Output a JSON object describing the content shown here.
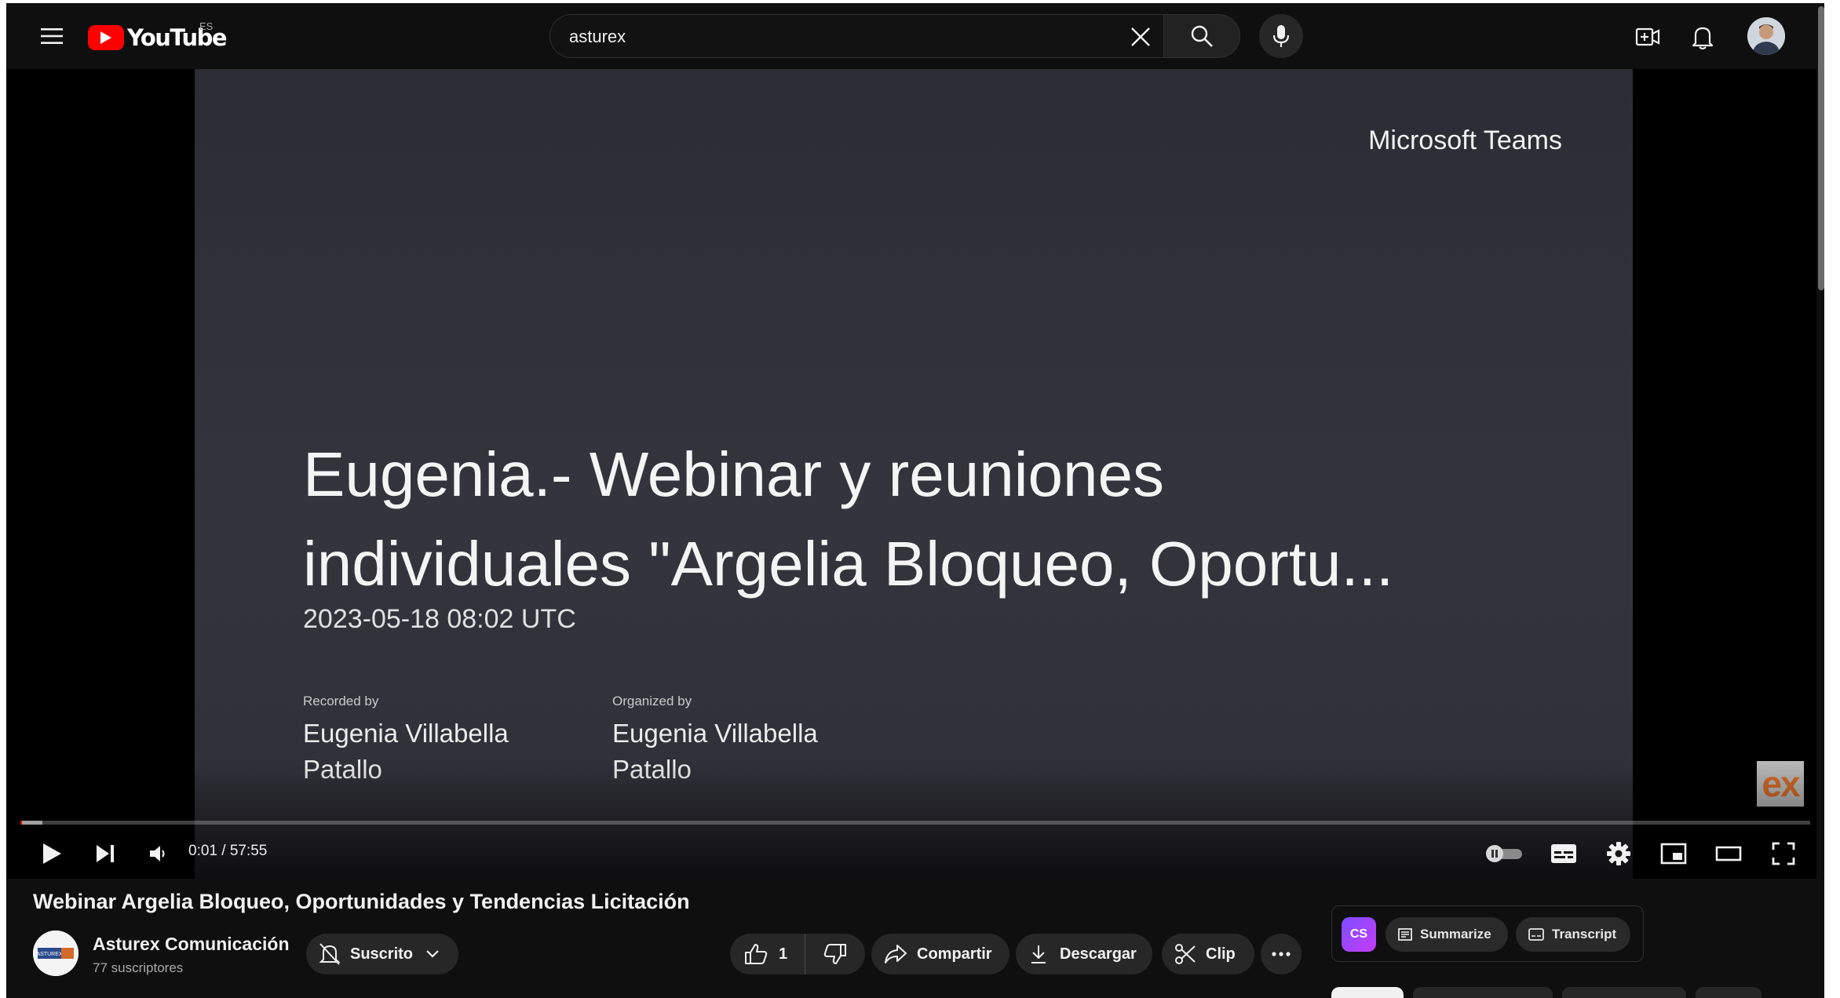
{
  "masthead": {
    "logo_text": "YouTube",
    "country_code": "ES",
    "search_value": "asturex"
  },
  "slide": {
    "brand": "Microsoft Teams",
    "title_line1": "Eugenia.- Webinar y reuniones",
    "title_line2": "individuales \"Argelia Bloqueo, Oportu...",
    "date": "2023-05-18 08:02 UTC",
    "recorded_label": "Recorded by",
    "recorded_name_line1": "Eugenia Villabella",
    "recorded_name_line2": "Patallo",
    "organized_label": "Organized by",
    "organized_name_line1": "Eugenia Villabella",
    "organized_name_line2": "Patallo",
    "watermark_text": "ex"
  },
  "player": {
    "current_time": "0:01",
    "time_separator": " / ",
    "duration": "57:55",
    "progress_fraction": 0.0003,
    "autoplay_on": false
  },
  "video": {
    "title": "Webinar Argelia Bloqueo, Oportunidades y Tendencias Licitación",
    "channel_name": "Asturex Comunicación",
    "subscribers": "77 suscriptores",
    "channel_avatar_text": "ASTUREX"
  },
  "actions": {
    "subscribe_label": "Suscrito",
    "like_count": "1",
    "share_label": "Compartir",
    "download_label": "Descargar",
    "clip_label": "Clip"
  },
  "extension": {
    "logo_text": "CS",
    "summarize_label": "Summarize",
    "transcript_label": "Transcript"
  },
  "colors": {
    "brand_red": "#ff0000",
    "background": "#0f0f0f",
    "pill_bg": "#272727"
  },
  "icons": [
    "menu-icon",
    "youtube-logo-icon",
    "close-icon",
    "search-icon",
    "mic-icon",
    "create-icon",
    "bell-icon",
    "play-icon",
    "next-icon",
    "volume-icon",
    "autoplay-toggle-icon",
    "subtitles-icon",
    "settings-gear-icon",
    "miniplayer-icon",
    "theater-icon",
    "fullscreen-icon",
    "bell-off-icon",
    "chevron-down-icon",
    "thumbs-up-icon",
    "thumbs-down-icon",
    "share-icon",
    "download-icon",
    "scissors-icon",
    "more-icon"
  ]
}
